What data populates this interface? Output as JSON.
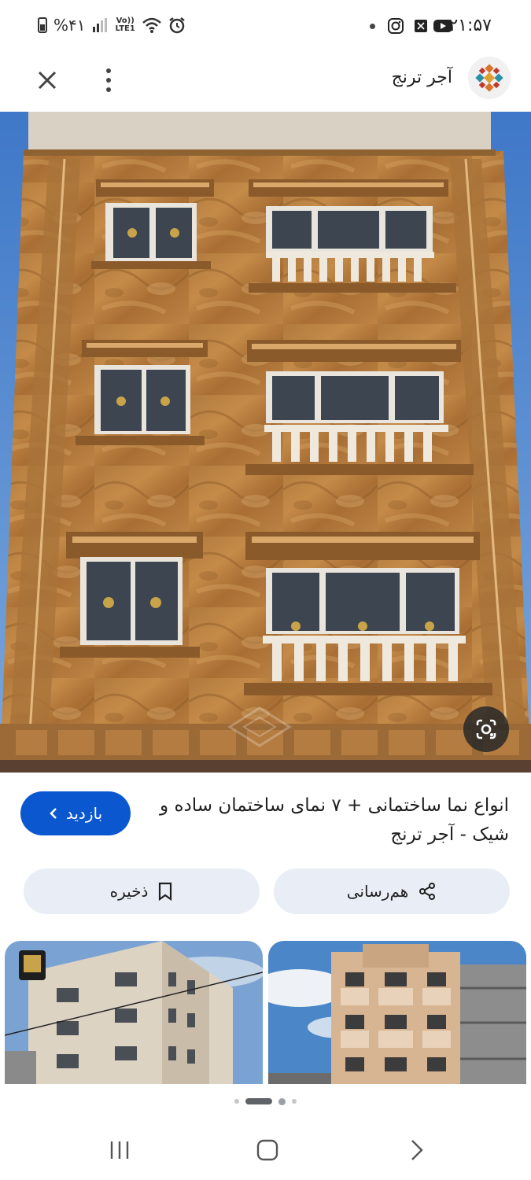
{
  "status_bar": {
    "time": "۲۱:۵۷",
    "battery": "%۴۱",
    "network": "LTE1",
    "volte": "Vo))",
    "apps": [
      "instagram-icon",
      "x-icon",
      "youtube-icon"
    ]
  },
  "header": {
    "site_name": "آجر ترنج",
    "close_icon": "close-icon",
    "menu_icon": "more-vert-icon"
  },
  "result": {
    "title": "انواع نما ساختمانی + ۷ نمای ساختمان ساده و شیک - آجر ترنج",
    "visit_label": "بازدید",
    "share_label": "هم‌رسانی",
    "save_label": "ذخیره"
  },
  "carousel": {
    "page_count": 5,
    "active_index": 1
  },
  "colors": {
    "accent": "#0b57d0",
    "chip_bg": "#e9eef6"
  }
}
